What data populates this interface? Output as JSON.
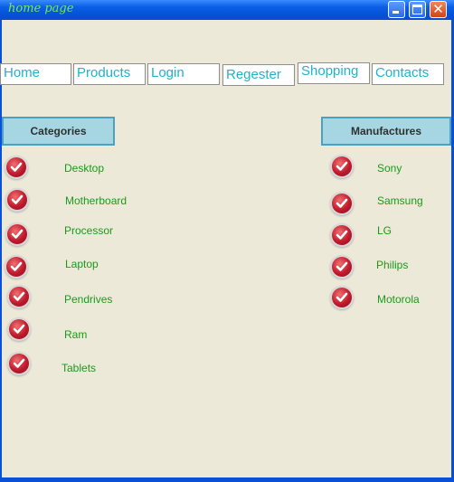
{
  "window": {
    "title": "home page"
  },
  "nav": [
    {
      "label": "Home"
    },
    {
      "label": "Products"
    },
    {
      "label": "Login"
    },
    {
      "label": "Regester"
    },
    {
      "label": "Shopping"
    },
    {
      "label": "Contacts"
    }
  ],
  "categories": {
    "heading": "Categories",
    "items": [
      {
        "label": "Desktop"
      },
      {
        "label": "Motherboard"
      },
      {
        "label": "Processor"
      },
      {
        "label": "Laptop"
      },
      {
        "label": "Pendrives"
      },
      {
        "label": "Ram"
      },
      {
        "label": "Tablets"
      }
    ]
  },
  "manufactures": {
    "heading": "Manufactures",
    "items": [
      {
        "label": "Sony"
      },
      {
        "label": "Samsung"
      },
      {
        "label": "LG"
      },
      {
        "label": "Philips"
      },
      {
        "label": "Motorola"
      }
    ]
  },
  "colors": {
    "accent": "#1fb3cc",
    "item_text": "#1a9a1a",
    "check": "#c01a2c",
    "header_bg": "#a6d6e2"
  },
  "icons": {
    "item_marker": "check-circle-icon"
  }
}
